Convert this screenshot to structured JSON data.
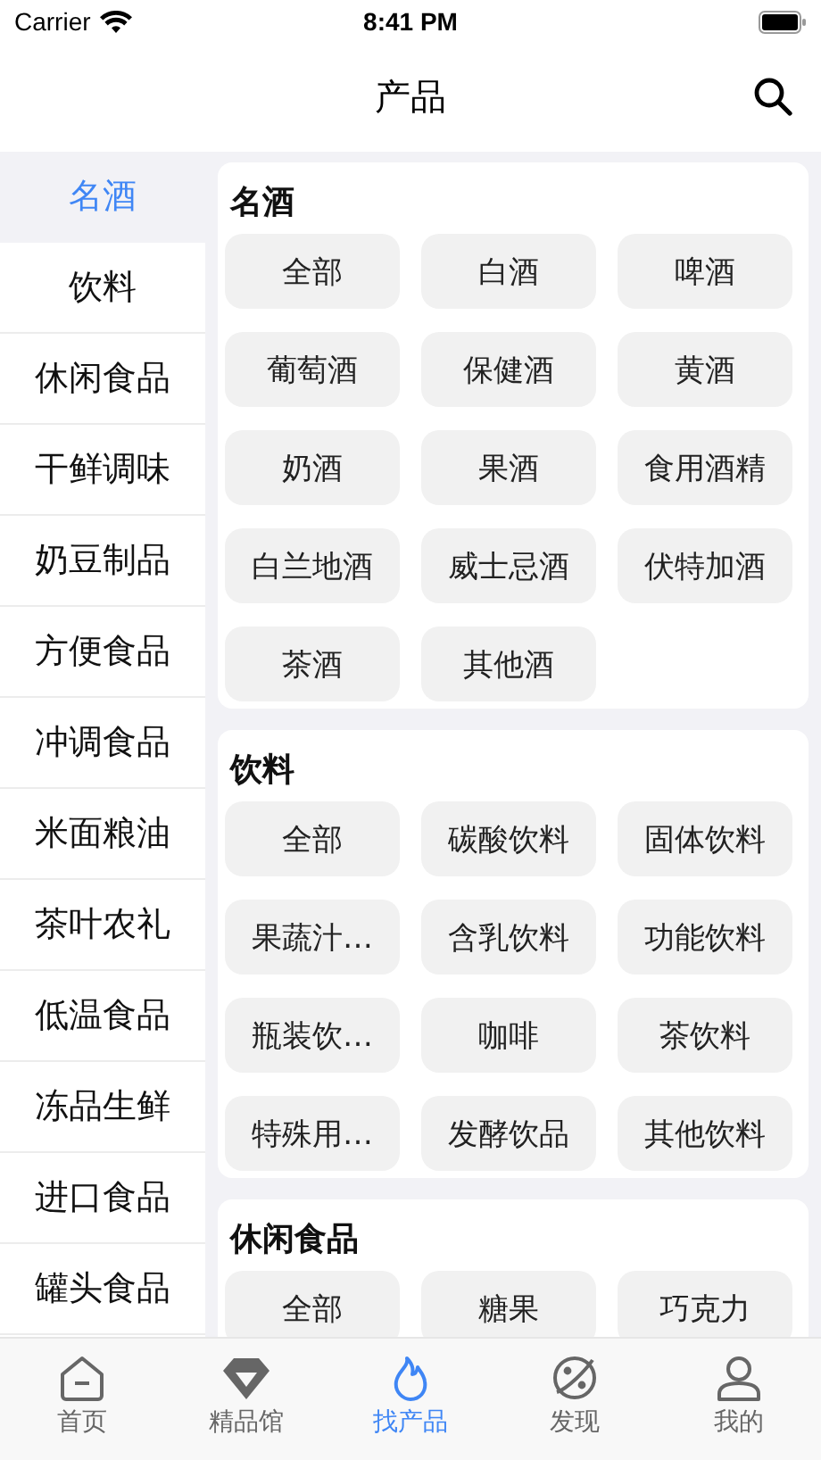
{
  "status_bar": {
    "carrier": "Carrier",
    "time": "8:41 PM"
  },
  "nav_bar": {
    "title": "产品"
  },
  "sidebar": {
    "items": [
      {
        "label": "名酒",
        "selected": true
      },
      {
        "label": "饮料",
        "selected": false
      },
      {
        "label": "休闲食品",
        "selected": false
      },
      {
        "label": "干鲜调味",
        "selected": false
      },
      {
        "label": "奶豆制品",
        "selected": false
      },
      {
        "label": "方便食品",
        "selected": false
      },
      {
        "label": "冲调食品",
        "selected": false
      },
      {
        "label": "米面粮油",
        "selected": false
      },
      {
        "label": "茶叶农礼",
        "selected": false
      },
      {
        "label": "低温食品",
        "selected": false
      },
      {
        "label": "冻品生鲜",
        "selected": false
      },
      {
        "label": "进口食品",
        "selected": false
      },
      {
        "label": "罐头食品",
        "selected": false
      }
    ]
  },
  "sections": [
    {
      "title": "名酒",
      "chips": [
        "全部",
        "白酒",
        "啤酒",
        "葡萄酒",
        "保健酒",
        "黄酒",
        "奶酒",
        "果酒",
        "食用酒精",
        "白兰地酒",
        "威士忌酒",
        "伏特加酒",
        "茶酒",
        "其他酒"
      ]
    },
    {
      "title": "饮料",
      "chips": [
        "全部",
        "碳酸饮料",
        "固体饮料",
        "果蔬汁…",
        "含乳饮料",
        "功能饮料",
        "瓶装饮…",
        "咖啡",
        "茶饮料",
        "特殊用…",
        "发酵饮品",
        "其他饮料"
      ]
    },
    {
      "title": "休闲食品",
      "chips": [
        "全部",
        "糖果",
        "巧克力"
      ]
    }
  ],
  "tab_bar": {
    "items": [
      {
        "label": "首页",
        "kind": "home",
        "selected": false
      },
      {
        "label": "精品馆",
        "kind": "gem",
        "selected": false
      },
      {
        "label": "找产品",
        "kind": "flame",
        "selected": true
      },
      {
        "label": "发现",
        "kind": "planet",
        "selected": false
      },
      {
        "label": "我的",
        "kind": "person",
        "selected": false
      }
    ]
  }
}
